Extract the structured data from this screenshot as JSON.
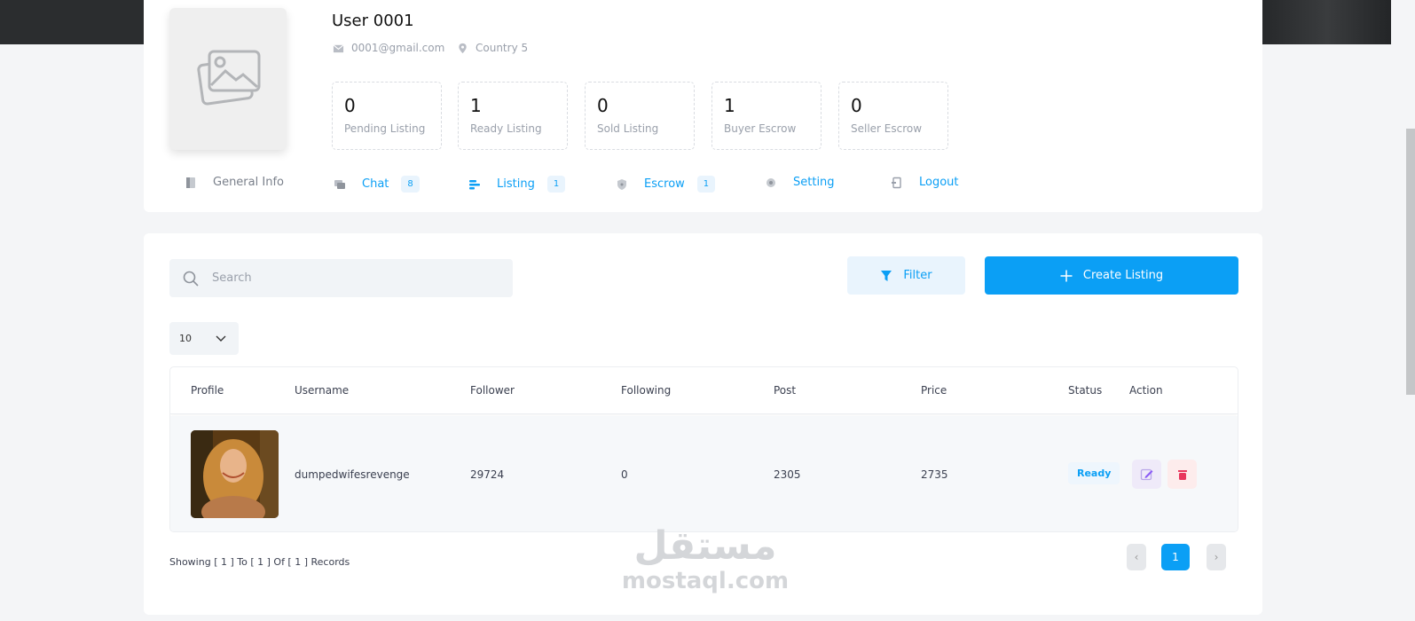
{
  "user": {
    "name": "User 0001",
    "email": "0001@gmail.com",
    "country": "Country 5"
  },
  "stats": [
    {
      "value": "0",
      "label": "Pending Listing"
    },
    {
      "value": "1",
      "label": "Ready Listing"
    },
    {
      "value": "0",
      "label": "Sold Listing"
    },
    {
      "value": "1",
      "label": "Buyer Escrow"
    },
    {
      "value": "0",
      "label": "Seller Escrow"
    }
  ],
  "tabs": [
    {
      "label": "General Info",
      "icon": "document-icon"
    },
    {
      "label": "Chat",
      "count": "8",
      "icon": "chat-icon"
    },
    {
      "label": "Listing",
      "count": "1",
      "icon": "list-icon"
    },
    {
      "label": "Escrow",
      "count": "1",
      "icon": "shield-icon"
    },
    {
      "label": "Setting",
      "icon": "gear-icon"
    },
    {
      "label": "Logout",
      "icon": "logout-icon"
    }
  ],
  "toolbar": {
    "search_placeholder": "Search",
    "filter_label": "Filter",
    "create_label": "Create Listing",
    "per_page": "10"
  },
  "table": {
    "headers": [
      "Profile",
      "Username",
      "Follower",
      "Following",
      "Post",
      "Price",
      "Status",
      "Action"
    ],
    "rows": [
      {
        "username": "dumpedwifesrevenge",
        "follower": "29724",
        "following": "0",
        "post": "2305",
        "price": "2735",
        "status": "Ready"
      }
    ]
  },
  "footer": {
    "records": "Showing [ 1 ] To [ 1 ] Of [ 1 ] Records",
    "current_page": "1",
    "prev": "‹",
    "next": "›"
  },
  "watermark": {
    "arabic": "مستقل",
    "latin": "mostaql.com"
  },
  "colors": {
    "accent": "#0b9ff5",
    "background": "#f4f5f7",
    "danger": "#e8365d",
    "edit": "#8b5cf6"
  }
}
